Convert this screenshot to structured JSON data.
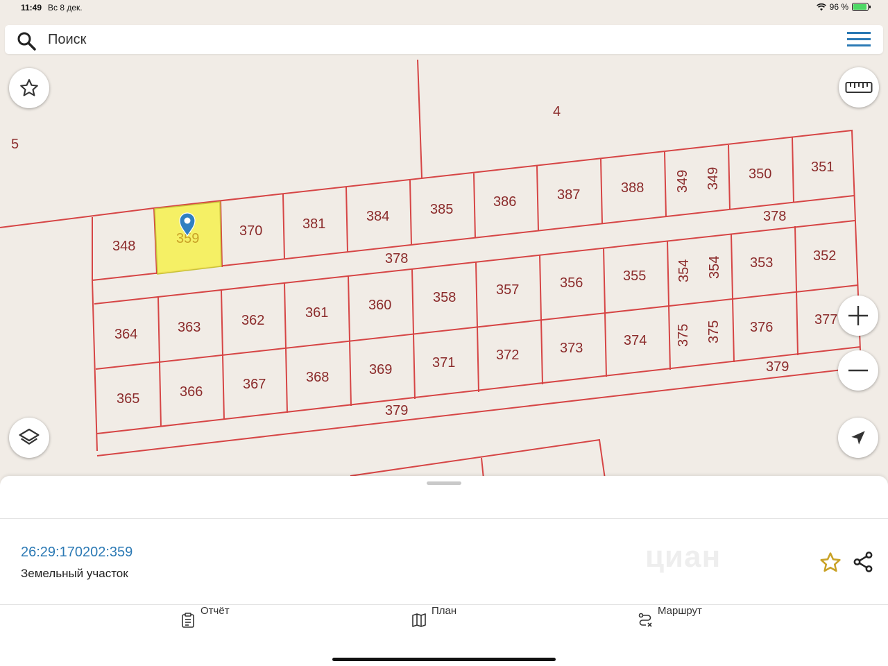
{
  "status_bar": {
    "time": "11:49",
    "date": "Вс 8 дек.",
    "battery": "96 %"
  },
  "search": {
    "placeholder": "Поиск"
  },
  "map": {
    "zone_labels": {
      "north": "4",
      "west": "5"
    },
    "top_row": [
      "348",
      "359",
      "370",
      "381",
      "384",
      "385",
      "386",
      "387",
      "388",
      "349",
      "349",
      "350",
      "351"
    ],
    "road_378": "378",
    "middle_row": [
      "354",
      "354",
      "353",
      "352",
      "358",
      "357",
      "356",
      "355"
    ],
    "row_364": [
      "364",
      "363",
      "362",
      "361",
      "360",
      "375",
      "375",
      "376",
      "377"
    ],
    "row_365": [
      "365",
      "366",
      "367",
      "368",
      "369",
      "371",
      "372",
      "373",
      "374"
    ],
    "road_379": "379",
    "selected_parcel": "359",
    "colors": {
      "parcel_border": "#d64545",
      "selected_fill": "#f5f05a",
      "marker": "#2f7fc1"
    }
  },
  "controls": [
    "star-icon",
    "ruler-icon",
    "layers-icon",
    "zoom-in-icon",
    "zoom-out-icon",
    "locate-icon"
  ],
  "parcel": {
    "number": "26:29:170202:359",
    "type": "Земельный участок",
    "watermark": "циан"
  },
  "tabs": {
    "report": "Отчёт",
    "plan": "План",
    "route": "Маршрут"
  }
}
